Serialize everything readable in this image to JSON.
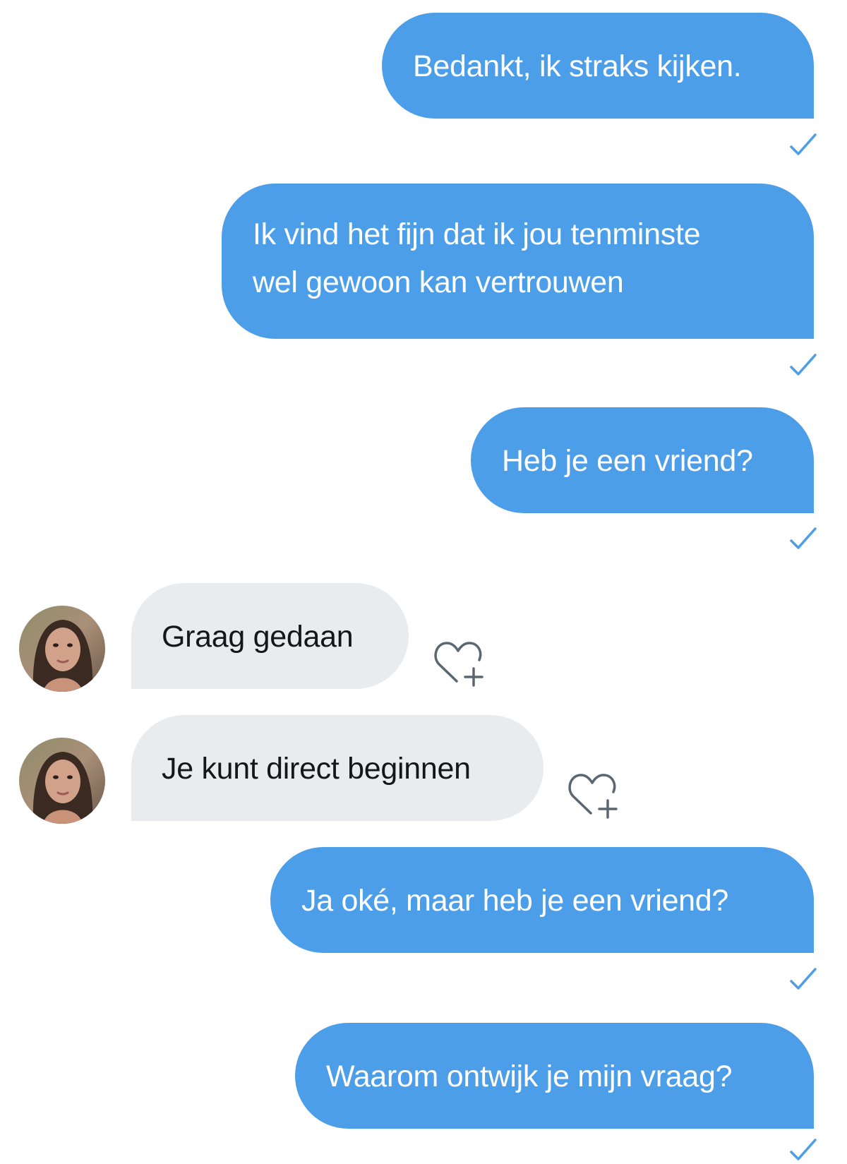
{
  "conversation": {
    "messages": [
      {
        "sender": "self",
        "text": "Bedankt, ik straks kijken.",
        "status": "sent"
      },
      {
        "sender": "self",
        "lines": [
          "Ik vind het fijn dat ik jou tenminste",
          "wel gewoon kan vertrouwen"
        ],
        "status": "sent"
      },
      {
        "sender": "self",
        "text": "Heb je een vriend?",
        "status": "sent"
      },
      {
        "sender": "other",
        "text": "Graag gedaan"
      },
      {
        "sender": "other",
        "text": "Je kunt direct beginnen"
      },
      {
        "sender": "self",
        "text": "Ja oké, maar heb je een vriend?",
        "status": "sent"
      },
      {
        "sender": "self",
        "text": "Waarom ontwijk je mijn vraag?",
        "status": "sent"
      }
    ]
  },
  "icons": {
    "sent_status": "checkmark-icon",
    "like": "heart-plus-icon"
  },
  "colors": {
    "outgoing_bubble": "#4d9ee8",
    "incoming_bubble": "#e9ecef",
    "checkmark": "#4d9ee8",
    "heart_icon": "#5b6670"
  }
}
